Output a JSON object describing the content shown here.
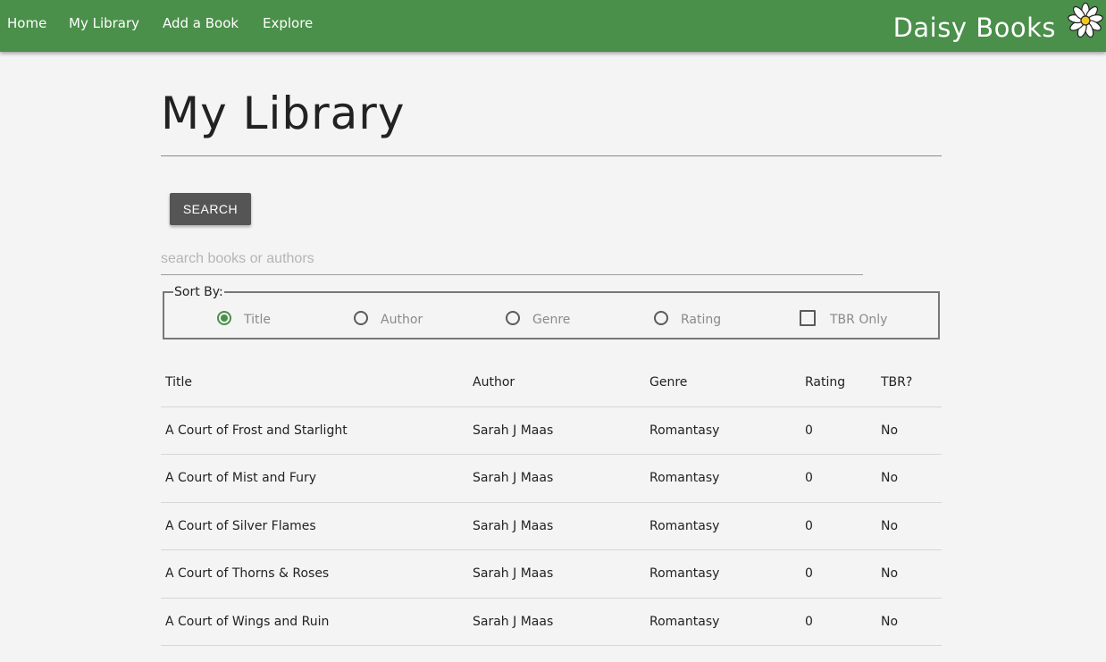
{
  "nav": {
    "links": [
      "Home",
      "My Library",
      "Add a Book",
      "Explore"
    ],
    "brand": "Daisy Books",
    "brand_icon": "daisy-flower-icon",
    "bar_color": "#4a8f4a"
  },
  "page": {
    "title": "My Library"
  },
  "search": {
    "button_label": "SEARCH",
    "placeholder": "search books or authors",
    "value": ""
  },
  "sort": {
    "legend": "Sort By:",
    "options": [
      "Title",
      "Author",
      "Genre",
      "Rating"
    ],
    "selected": "Title",
    "tbr_label": "TBR Only",
    "tbr_checked": false,
    "accent_color": "#4a8f4a"
  },
  "table": {
    "headers": [
      "Title",
      "Author",
      "Genre",
      "Rating",
      "TBR?"
    ],
    "rows": [
      [
        "A Court of Frost and Starlight",
        "Sarah J Maas",
        "Romantasy",
        "0",
        "No"
      ],
      [
        "A Court of Mist and Fury",
        "Sarah J Maas",
        "Romantasy",
        "0",
        "No"
      ],
      [
        "A Court of Silver Flames",
        "Sarah J Maas",
        "Romantasy",
        "0",
        "No"
      ],
      [
        "A Court of Thorns & Roses",
        "Sarah J Maas",
        "Romantasy",
        "0",
        "No"
      ],
      [
        "A Court of Wings and Ruin",
        "Sarah J Maas",
        "Romantasy",
        "0",
        "No"
      ]
    ]
  }
}
